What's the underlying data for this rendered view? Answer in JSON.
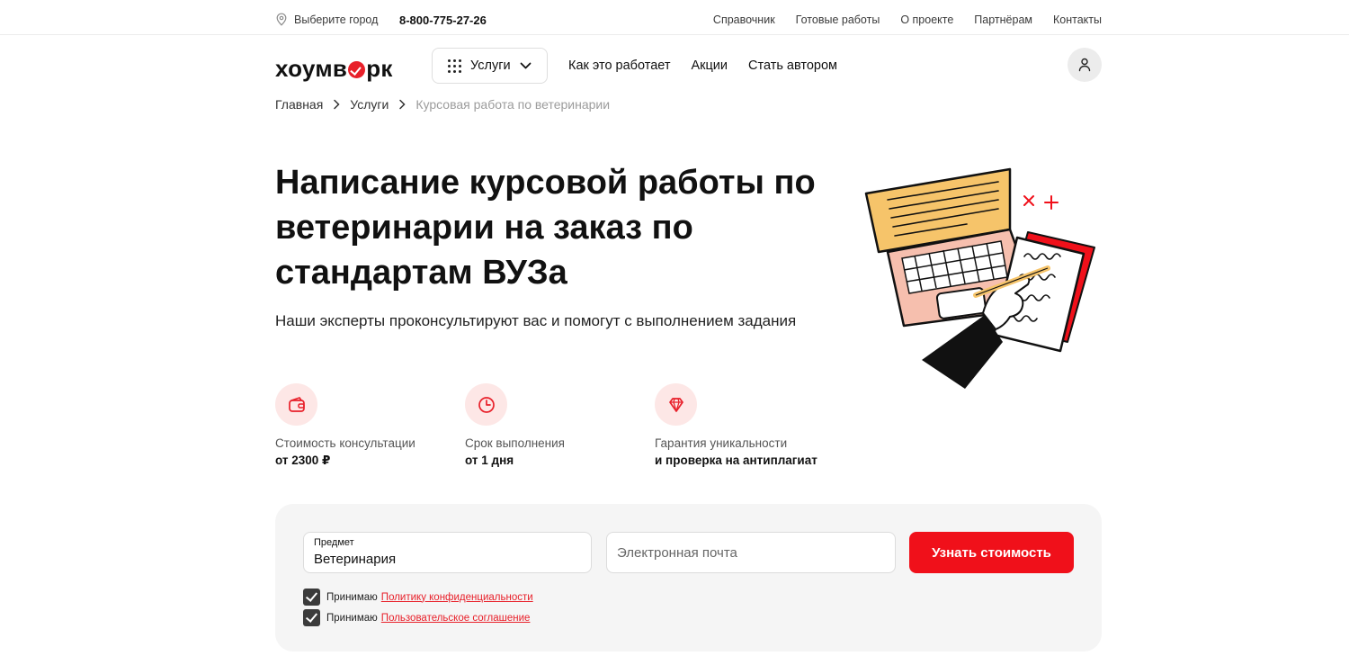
{
  "topbar": {
    "city_label": "Выберите город",
    "phone": "8-800-775-27-26",
    "links": [
      "Справочник",
      "Готовые работы",
      "О проекте",
      "Партнёрам",
      "Контакты"
    ]
  },
  "header": {
    "logo_part1": "хоумв",
    "logo_part2": "рк",
    "services_label": "Услуги",
    "nav": [
      "Как это работает",
      "Акции",
      "Стать автором"
    ]
  },
  "breadcrumb": {
    "home": "Главная",
    "services": "Услуги",
    "current": "Курсовая работа по ветеринарии"
  },
  "hero": {
    "title": "Написание курсовой работы по ветеринарии на заказ по стандартам ВУЗа",
    "subtitle": "Наши эксперты проконсультируют вас и помогут с выполнением задания"
  },
  "features": [
    {
      "icon": "wallet-icon",
      "label": "Стоимость консультации",
      "value": "от 2300 ₽"
    },
    {
      "icon": "clock-icon",
      "label": "Срок выполнения",
      "value": "от 1 дня"
    },
    {
      "icon": "diamond-icon",
      "label": "Гарантия уникальности",
      "value": "и проверка на антиплагиат"
    }
  ],
  "order_form": {
    "subject_label": "Предмет",
    "subject_value": "Ветеринария",
    "email_placeholder": "Электронная почта",
    "submit_label": "Узнать стоимость",
    "consent_prefix": "Принимаю",
    "privacy_link": "Политику конфиденциальности",
    "terms_link": "Пользовательское соглашение"
  },
  "colors": {
    "accent": "#f0101a",
    "icon_bg": "#fde7e6",
    "form_bg": "#f5f5f5"
  }
}
